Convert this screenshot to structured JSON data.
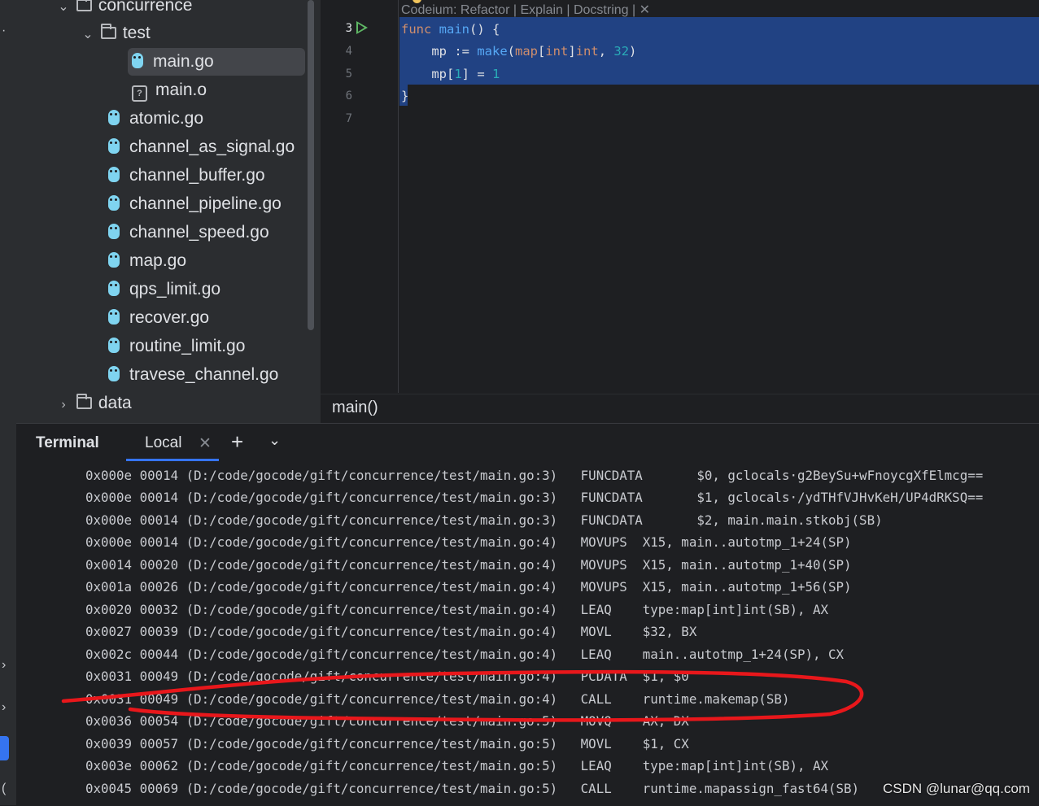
{
  "project": {
    "rows": [
      {
        "label": "concurrence",
        "kind": "folder",
        "expanded": true
      },
      {
        "label": "test",
        "kind": "folder",
        "expanded": true
      },
      {
        "label": "main.go",
        "kind": "go",
        "selected": true
      },
      {
        "label": "main.o",
        "kind": "unknown"
      },
      {
        "label": "atomic.go",
        "kind": "go"
      },
      {
        "label": "channel_as_signal.go",
        "kind": "go"
      },
      {
        "label": "channel_buffer.go",
        "kind": "go"
      },
      {
        "label": "channel_pipeline.go",
        "kind": "go"
      },
      {
        "label": "channel_speed.go",
        "kind": "go"
      },
      {
        "label": "map.go",
        "kind": "go"
      },
      {
        "label": "qps_limit.go",
        "kind": "go"
      },
      {
        "label": "recover.go",
        "kind": "go"
      },
      {
        "label": "routine_limit.go",
        "kind": "go"
      },
      {
        "label": "travese_channel.go",
        "kind": "go"
      },
      {
        "label": "data",
        "kind": "folder",
        "expanded": false
      }
    ]
  },
  "editor": {
    "codeium_lens": "Codeium: Refactor | Explain | Docstring | ✕",
    "line_numbers": [
      "3",
      "4",
      "5",
      "6",
      "7"
    ],
    "code": {
      "l3_kw": "func",
      "l3_name": "main",
      "l3_rest": "() {",
      "l4_indent": "    mp := ",
      "l4_make": "make",
      "l4_paren": "(",
      "l4_map": "map",
      "l4_lb": "[",
      "l4_int1": "int",
      "l4_rb": "]",
      "l4_int2": "int",
      "l4_comma": ", ",
      "l4_num": "32",
      "l4_close": ")",
      "l5_pre": "    mp[",
      "l5_idx": "1",
      "l5_mid": "] = ",
      "l5_val": "1",
      "l6": "}"
    },
    "breadcrumb": "main()"
  },
  "terminal": {
    "title": "Terminal",
    "tab_label": "Local",
    "close_glyph": "✕",
    "add_glyph": "+",
    "menu_glyph": "⌄",
    "lines": [
      "0x000e 00014 (D:/code/gocode/gift/concurrence/test/main.go:3)   FUNCDATA       $0, gclocals·g2BeySu+wFnoycgXfElmcg==",
      "0x000e 00014 (D:/code/gocode/gift/concurrence/test/main.go:3)   FUNCDATA       $1, gclocals·/ydTHfVJHvKeH/UP4dRKSQ==",
      "0x000e 00014 (D:/code/gocode/gift/concurrence/test/main.go:3)   FUNCDATA       $2, main.main.stkobj(SB)",
      "0x000e 00014 (D:/code/gocode/gift/concurrence/test/main.go:4)   MOVUPS  X15, main..autotmp_1+24(SP)",
      "0x0014 00020 (D:/code/gocode/gift/concurrence/test/main.go:4)   MOVUPS  X15, main..autotmp_1+40(SP)",
      "0x001a 00026 (D:/code/gocode/gift/concurrence/test/main.go:4)   MOVUPS  X15, main..autotmp_1+56(SP)",
      "0x0020 00032 (D:/code/gocode/gift/concurrence/test/main.go:4)   LEAQ    type:map[int]int(SB), AX",
      "0x0027 00039 (D:/code/gocode/gift/concurrence/test/main.go:4)   MOVL    $32, BX",
      "0x002c 00044 (D:/code/gocode/gift/concurrence/test/main.go:4)   LEAQ    main..autotmp_1+24(SP), CX",
      "0x0031 00049 (D:/code/gocode/gift/concurrence/test/main.go:4)   PCDATA  $1, $0",
      "0x0031 00049 (D:/code/gocode/gift/concurrence/test/main.go:4)   CALL    runtime.makemap(SB)",
      "0x0036 00054 (D:/code/gocode/gift/concurrence/test/main.go:5)   MOVQ    AX, DX",
      "0x0039 00057 (D:/code/gocode/gift/concurrence/test/main.go:5)   MOVL    $1, CX",
      "0x003e 00062 (D:/code/gocode/gift/concurrence/test/main.go:5)   LEAQ    type:map[int]int(SB), AX",
      "0x0045 00069 (D:/code/gocode/gift/concurrence/test/main.go:5)   CALL    runtime.mapassign_fast64(SB)"
    ]
  },
  "watermark": "CSDN @lunar@qq.com",
  "colors": {
    "selection": "#214283",
    "accent": "#3574f0",
    "annotation": "#e8171b",
    "run": "#5fb865"
  }
}
